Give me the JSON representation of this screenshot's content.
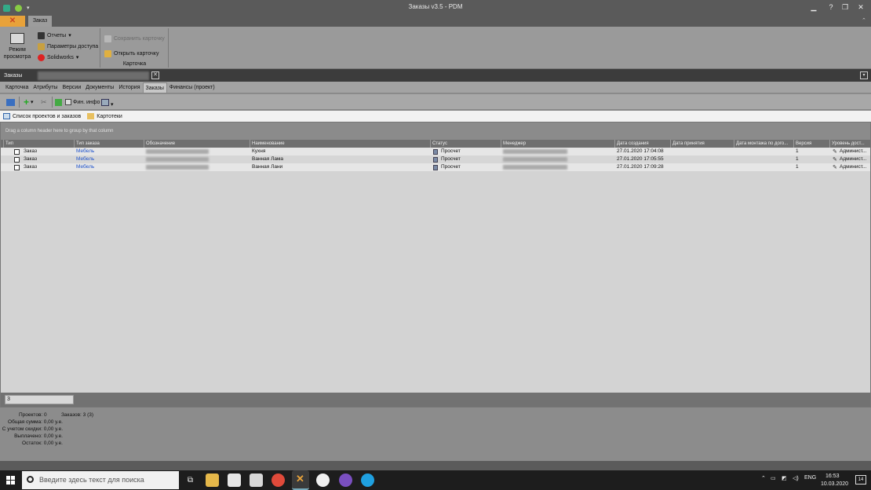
{
  "window": {
    "title": "Заказы v3.5 - PDM"
  },
  "ribbon": {
    "tab_label": "Заказ",
    "group1": {
      "view_mode_label": "Режим просмотра",
      "reports": "Отчеты",
      "access_params": "Параметры доступа",
      "solidworks": "Solidworks"
    },
    "group2": {
      "save_card": "Сохранить карточку",
      "open_card": "Открыть карточку",
      "label": "Карточка"
    }
  },
  "doc_tab": {
    "label": "Заказы"
  },
  "inner_tabs": [
    "Карточка",
    "Атрибуты",
    "Версии",
    "Документы",
    "История",
    "Заказы",
    "Финансы (проект)"
  ],
  "inner_tab_active": "Заказы",
  "toolbar": {
    "fin_info": "Фин. инфо"
  },
  "sub_tabs": [
    "Список проектов и заказов",
    "Картотеки"
  ],
  "grid": {
    "group_hint": "Drag a column header here to group by that column",
    "columns": [
      "Тип",
      "Тип заказа",
      "Обозначение",
      "Наименование",
      "Статус",
      "Менеджер",
      "Дата создания",
      "Дата принятия",
      "Дата монтажа по дого...",
      "Версия",
      "Уровень дост..."
    ],
    "rows": [
      {
        "type": "Заказ",
        "order_type": "Мебель",
        "name": "Кухня",
        "status": "Просчет",
        "created": "27.01.2020 17:04:08",
        "version": "1",
        "access": "Админист..."
      },
      {
        "type": "Заказ",
        "order_type": "Мебель",
        "name": "Ванная Лама",
        "status": "Просчет",
        "created": "27.01.2020 17:05:55",
        "version": "1",
        "access": "Админист..."
      },
      {
        "type": "Заказ",
        "order_type": "Мебель",
        "name": "Ванная Лани",
        "status": "Просчет",
        "created": "27.01.2020 17:09:28",
        "version": "1",
        "access": "Админист..."
      }
    ],
    "footer_count": "3"
  },
  "summary": {
    "projects": "Проектов: 0",
    "orders": "Заказов: 3 (3)",
    "total": "Общая сумма: 0,00 у.е.",
    "with_discount": "С учетом скидки: 0,00 у.е.",
    "paid": "Выплачено: 0,00 у.е.",
    "remaining": "Остаток: 0,00 у.е."
  },
  "taskbar": {
    "search_placeholder": "Введите здесь текст для поиска",
    "lang": "ENG",
    "time": "16:53",
    "date": "10.03.2020",
    "notifications": "14"
  },
  "colors": {
    "accent_link": "#2255cc",
    "app_button": "#e8a23a"
  }
}
